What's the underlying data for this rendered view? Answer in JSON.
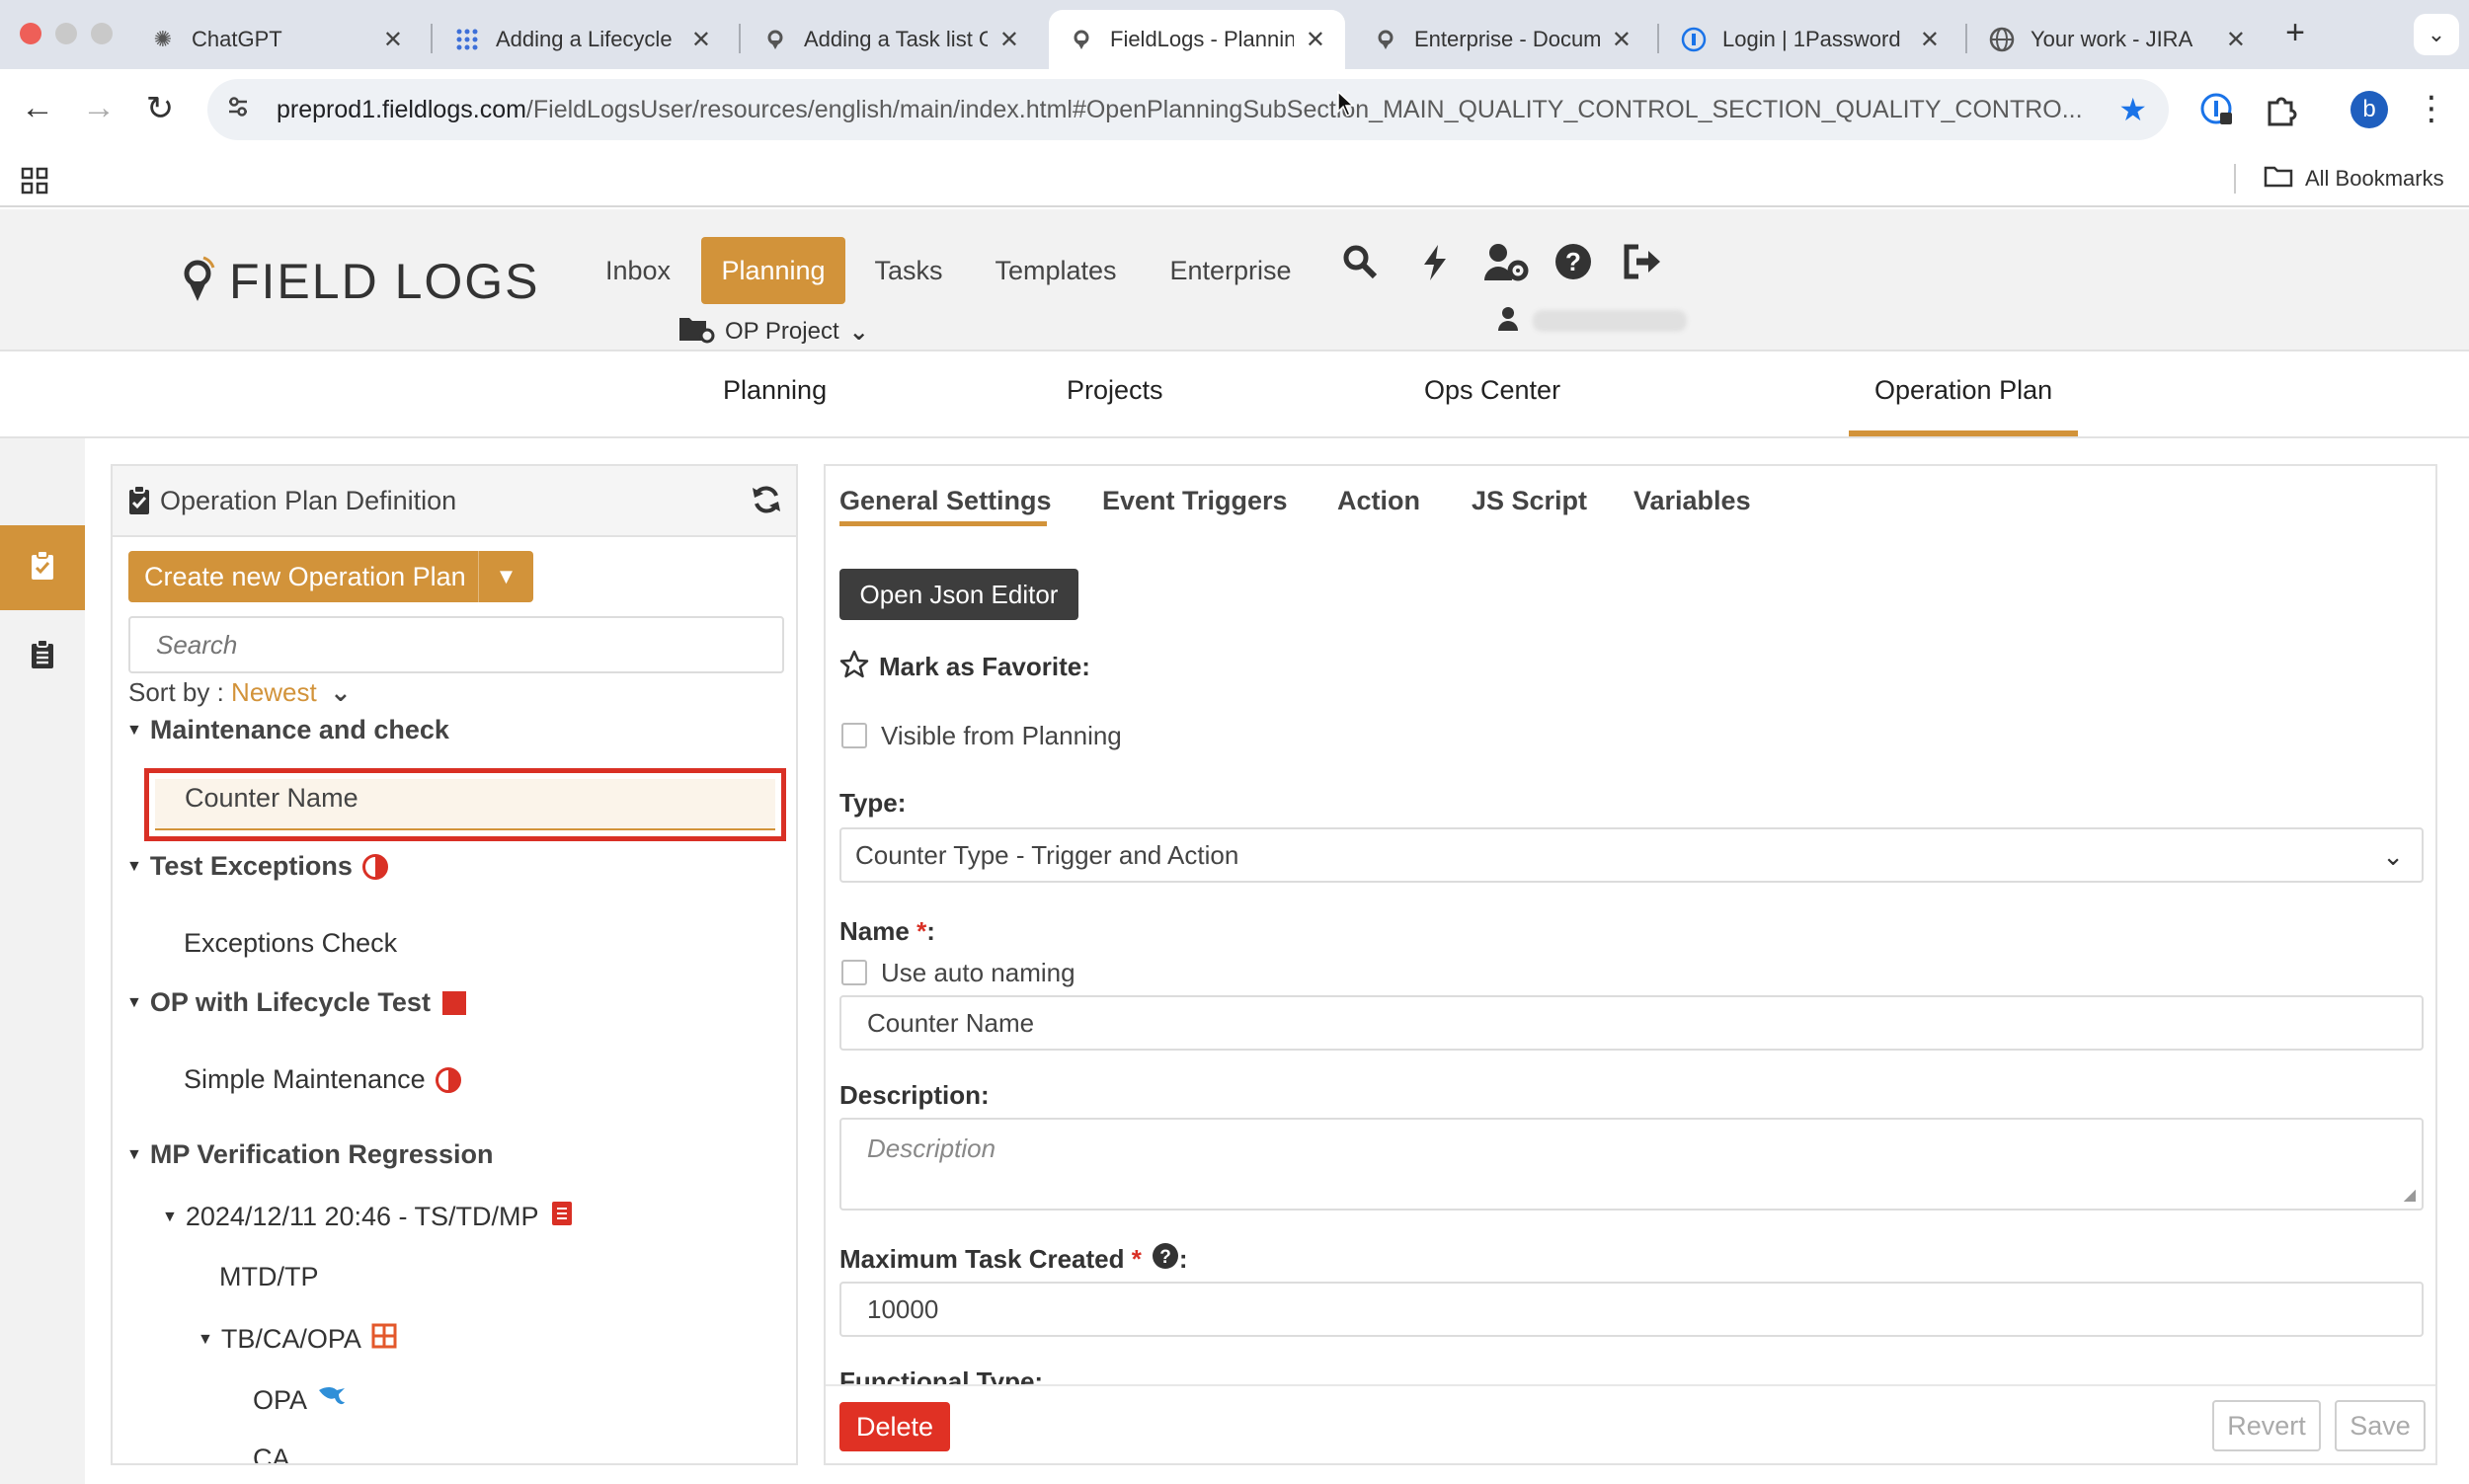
{
  "browser": {
    "tabs": [
      {
        "title": "ChatGPT",
        "icon": "chatgpt-icon"
      },
      {
        "title": "Adding a Lifecycle",
        "icon": "grid-app-icon"
      },
      {
        "title": "Adding a Task list C",
        "icon": "fieldlogs-pin-icon"
      },
      {
        "title": "FieldLogs - Plannin",
        "icon": "fieldlogs-pin-icon"
      },
      {
        "title": "Enterprise - Docum",
        "icon": "fieldlogs-pin-icon"
      },
      {
        "title": "Login | 1Password",
        "icon": "onepassword-icon"
      },
      {
        "title": "Your work - JIRA",
        "icon": "globe-icon"
      }
    ],
    "url_host": "preprod1.fieldlogs.com",
    "url_path": "/FieldLogsUser/resources/english/main/index.html#OpenPlanningSubSection_MAIN_QUALITY_CONTROL_SECTION_QUALITY_CONTRO...",
    "profile_initial": "b",
    "bookmarks_label": "All Bookmarks"
  },
  "app": {
    "logo_text": "FIELD LOGS",
    "main_nav": [
      "Inbox",
      "Planning",
      "Tasks",
      "Templates",
      "Enterprise"
    ],
    "project_selector": "OP Project",
    "sub_nav": [
      "Planning",
      "Projects",
      "Ops Center",
      "Operation Plan"
    ],
    "accent_color": "#d2933a"
  },
  "left_panel": {
    "title": "Operation Plan Definition",
    "create_button": "Create new Operation Plan",
    "search_placeholder": "Search",
    "sort_label": "Sort by : ",
    "sort_value": "Newest",
    "tree": {
      "g1": "Maintenance and check",
      "g1_item": "Counter Name",
      "g2": "Test Exceptions",
      "g2_item": "Exceptions Check",
      "g3": "OP with Lifecycle Test",
      "g3_item": "Simple Maintenance",
      "g4": "MP Verification Regression",
      "g4_sub": "2024/12/11 20:46 - TS/TD/MP",
      "g4_sub_item1": "MTD/TP",
      "g4_sub_group": "TB/CA/OPA",
      "g4_sub_group_item1": "OPA",
      "g4_sub_group_item2": "CA"
    }
  },
  "right_panel": {
    "tabs": [
      "General Settings",
      "Event Triggers",
      "Action",
      "JS Script",
      "Variables"
    ],
    "json_button": "Open Json Editor",
    "favorite_label": "Mark as Favorite:",
    "visible_label": "Visible from Planning",
    "type_label": "Type:",
    "type_value": "Counter Type - Trigger and Action",
    "name_label": "Name",
    "required_mark": "*",
    "colon": ":",
    "auto_naming_label": "Use auto naming",
    "name_value": "Counter Name",
    "description_label": "Description:",
    "description_placeholder": "Description",
    "max_task_label": "Maximum Task Created",
    "max_task_value": "10000",
    "functional_type_label": "Functional Type:",
    "delete_button": "Delete",
    "revert_button": "Revert",
    "save_button": "Save"
  }
}
